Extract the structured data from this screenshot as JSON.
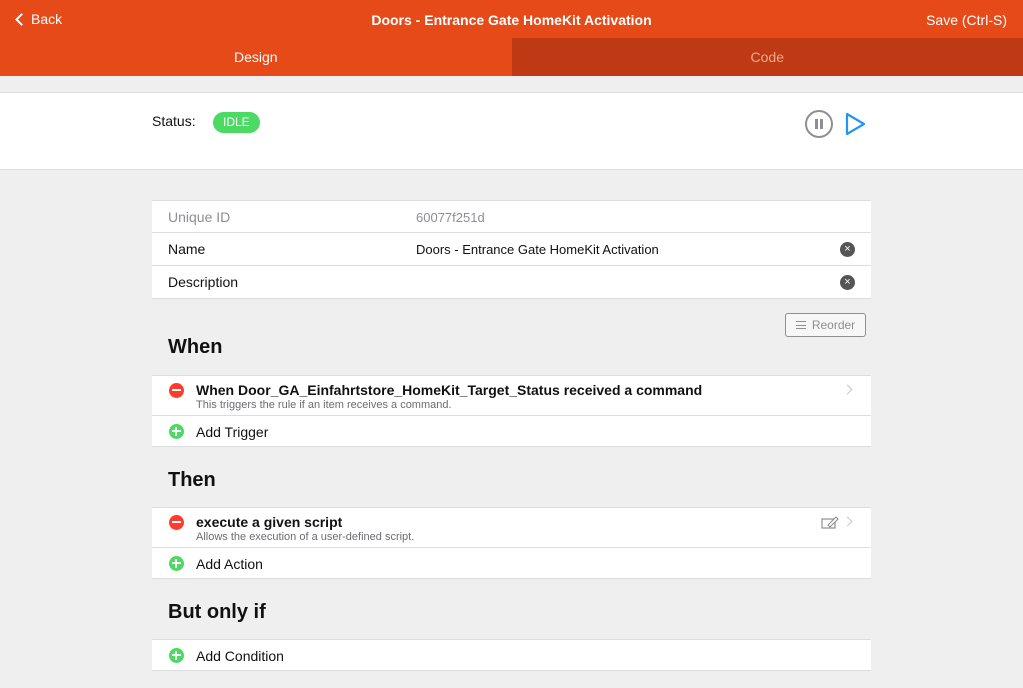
{
  "navbar": {
    "back_label": "Back",
    "title": "Doors - Entrance Gate HomeKit Activation",
    "save_label": "Save (Ctrl-S)"
  },
  "tabs": [
    {
      "label": "Design",
      "active": true
    },
    {
      "label": "Code",
      "active": false
    }
  ],
  "status": {
    "label": "Status:",
    "value": "IDLE",
    "badge_color": "#4cd964"
  },
  "fields": {
    "uid_label": "Unique ID",
    "uid_value": "60077f251d",
    "name_label": "Name",
    "name_value": "Doors - Entrance Gate HomeKit Activation",
    "description_label": "Description",
    "description_value": ""
  },
  "reorder_label": "Reorder",
  "when": {
    "heading": "When",
    "items": [
      {
        "title": "When Door_GA_Einfahrtstore_HomeKit_Target_Status received a command",
        "subtitle": "This triggers the rule if an item receives a command."
      }
    ],
    "add_label": "Add Trigger"
  },
  "then": {
    "heading": "Then",
    "items": [
      {
        "title": "execute a given script",
        "subtitle": "Allows the execution of a user-defined script."
      }
    ],
    "add_label": "Add Action"
  },
  "but_only_if": {
    "heading": "But only if",
    "add_label": "Add Condition"
  },
  "colors": {
    "accent": "#e64a19",
    "tab_inactive": "#bf3a14",
    "remove": "#ff3b30",
    "add": "#4cd964",
    "play": "#2196f3"
  }
}
